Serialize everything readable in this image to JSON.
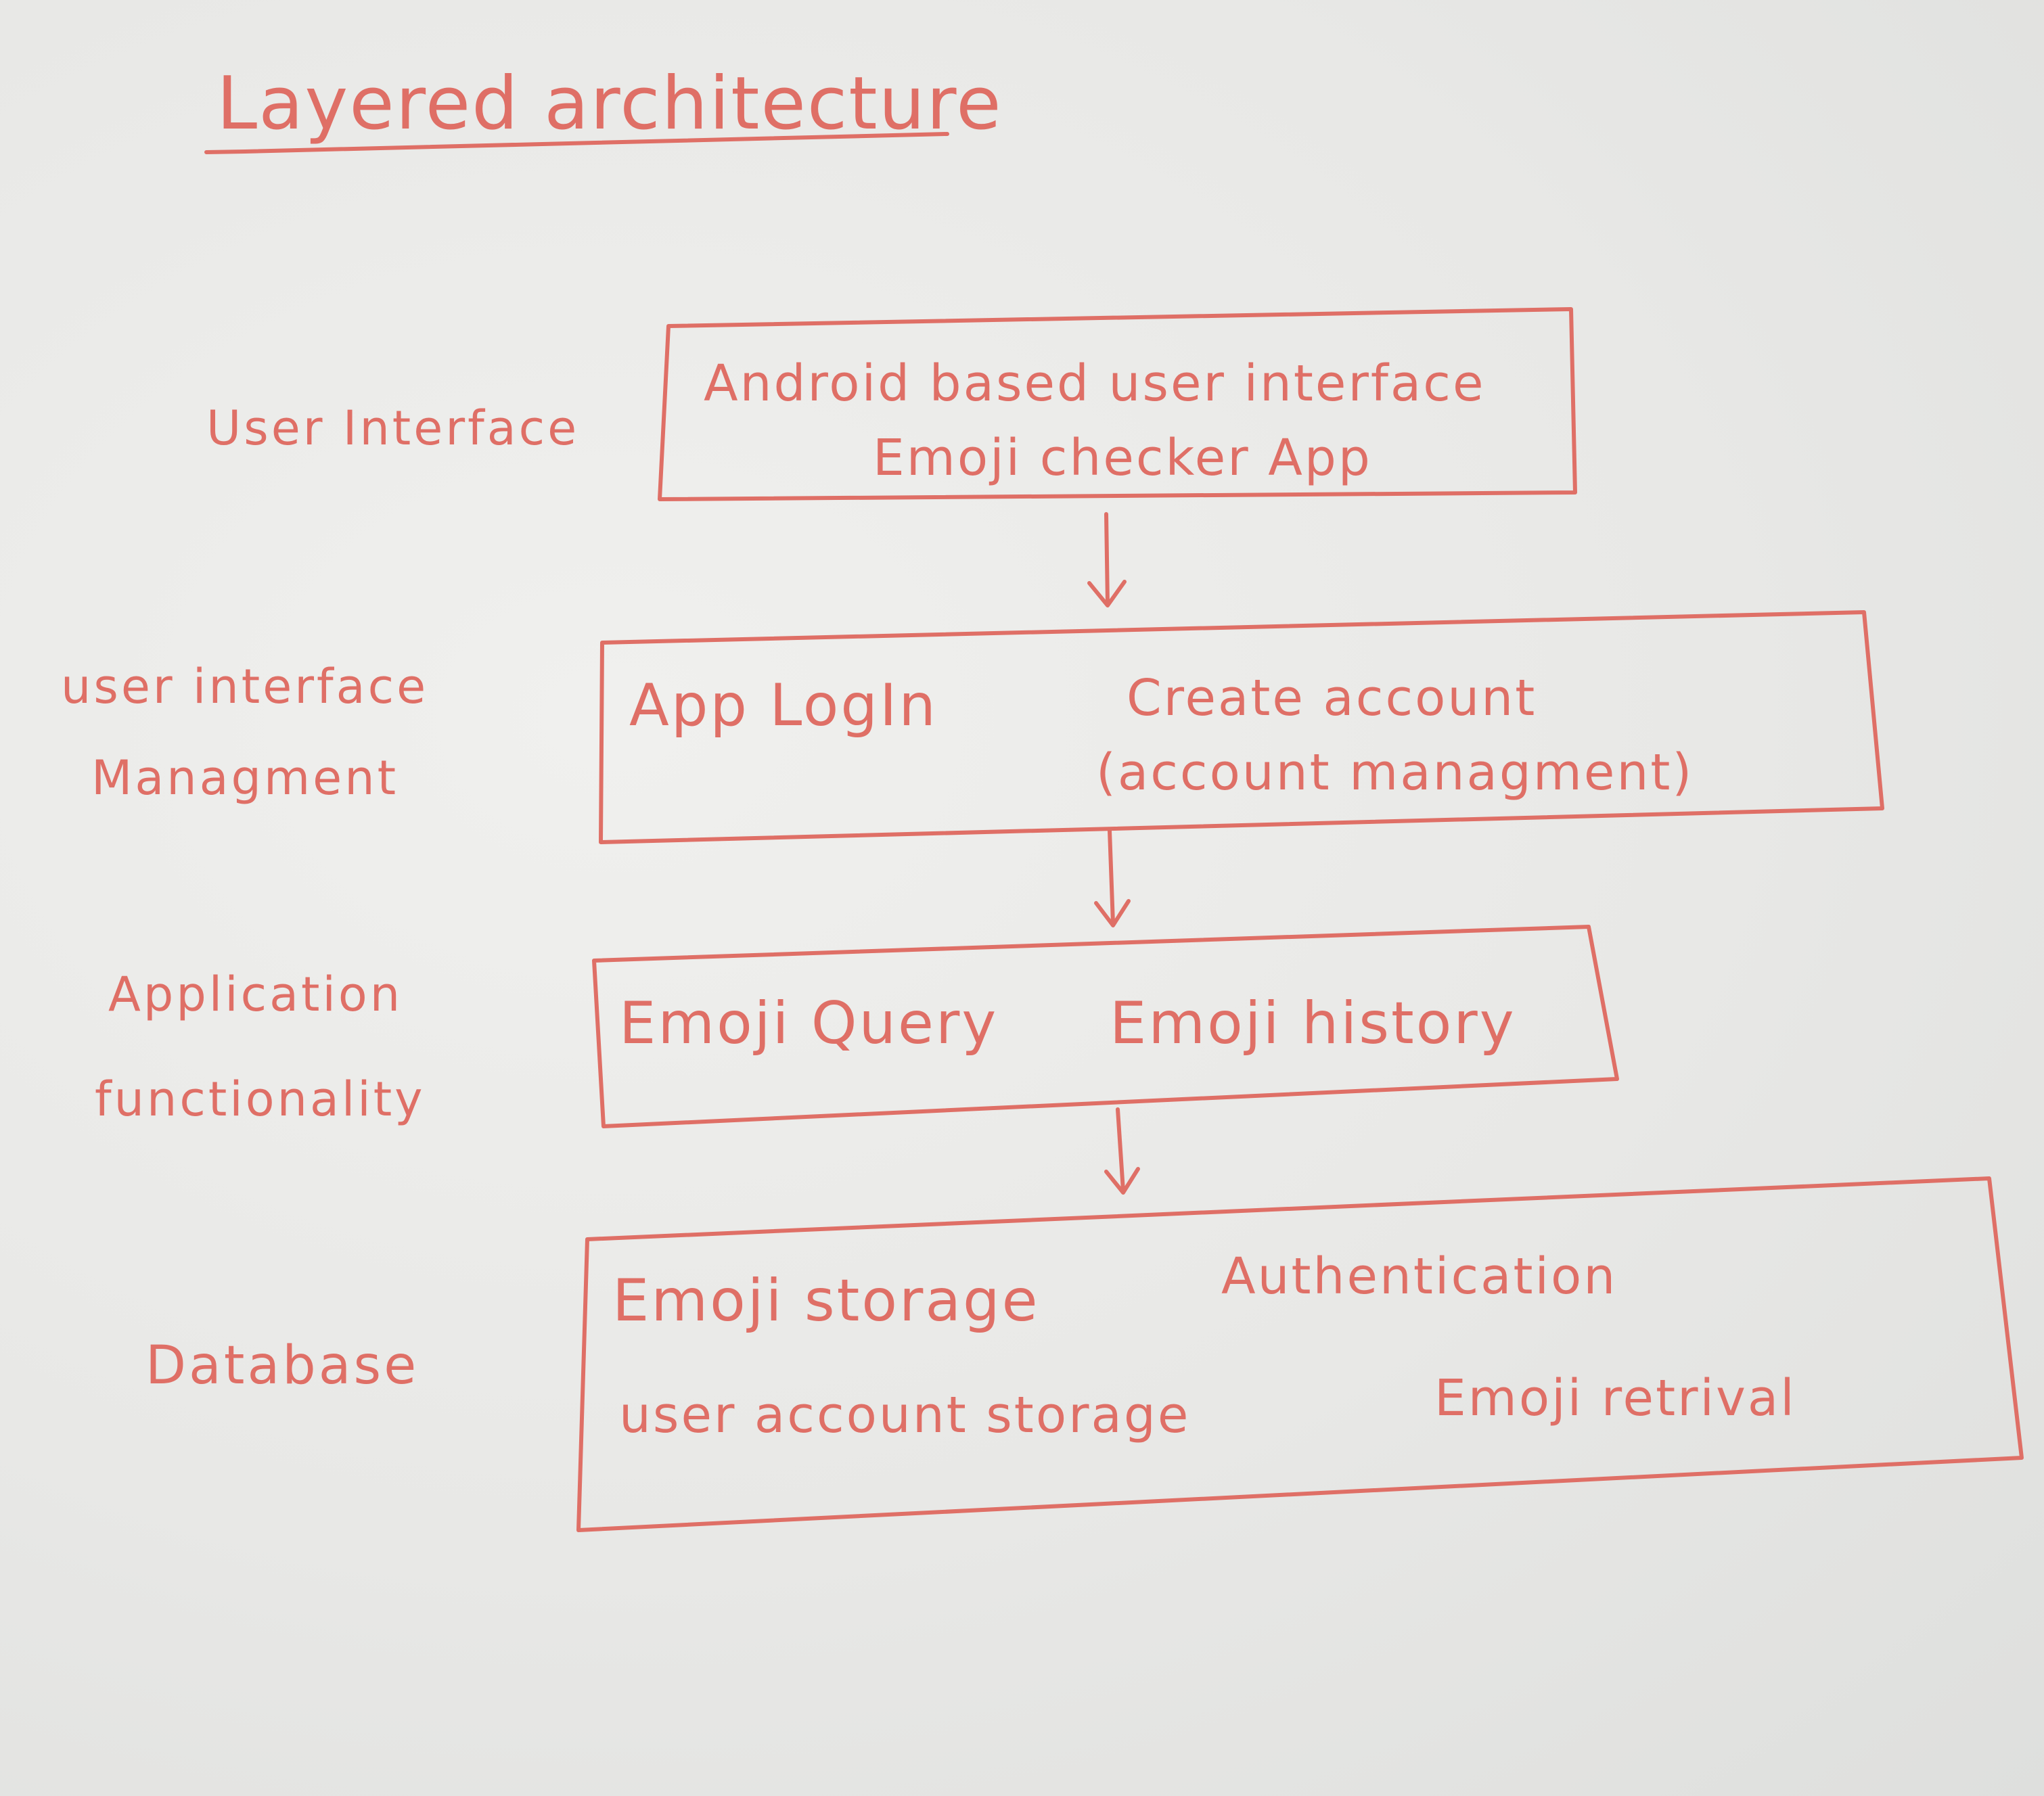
{
  "theme": {
    "ink": "#df6f66",
    "paper": "#ececea"
  },
  "title": "Layered architecture",
  "layers": [
    {
      "name": "User Interface",
      "items": [
        "Android based user interface",
        "Emoji checker App"
      ]
    },
    {
      "name_lines": [
        "user interface",
        "Managment"
      ],
      "items": [
        "App LogIn",
        "Create account",
        "(account managment)"
      ]
    },
    {
      "name_lines": [
        "Application",
        "functionality"
      ],
      "items": [
        "Emoji Query",
        "Emoji history"
      ]
    },
    {
      "name": "Database",
      "items": [
        "Emoji storage",
        "Authentication",
        "user account storage",
        "Emoji retrival"
      ]
    }
  ]
}
